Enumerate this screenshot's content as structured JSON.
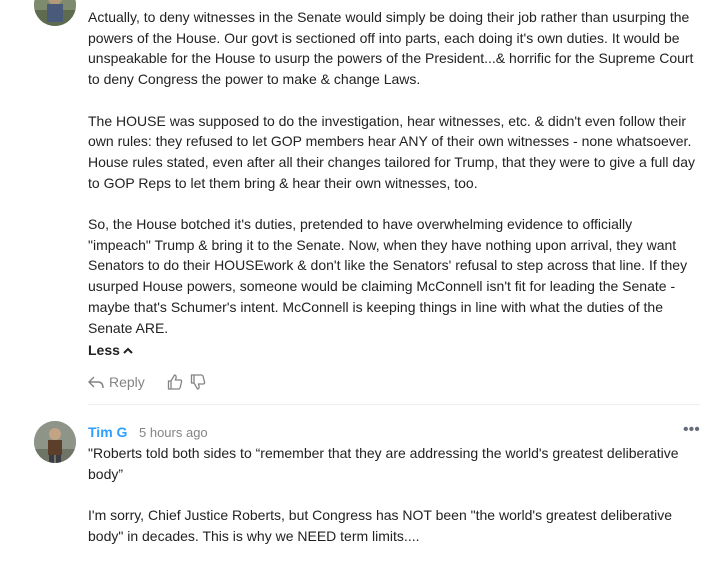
{
  "comment1": {
    "paragraphs": [
      "Actually, to deny witnesses in the Senate would simply be doing their job rather than usurping the powers of the House. Our govt is sectioned off into parts, each doing it's own duties. It would be unspeakable for the House to usurp the powers of the President...& horrific for the Supreme Court to deny Congress the power to make & change Laws.",
      "The HOUSE was supposed to do the investigation, hear witnesses, etc. & didn't even follow their own rules: they refused to let GOP members hear ANY of their own witnesses - none whatsoever. House rules stated, even after all their changes tailored for Trump, that they were to give a full day to GOP Reps to let them bring & hear their own witnesses, too.",
      "So, the House botched it's duties, pretended to have overwhelming evidence to officially \"impeach\" Trump & bring it to the Senate. Now, when they have nothing upon arrival, they want Senators to do their HOUSEwork & don't like the Senators' refusal to step across that line. If they usurped House powers, someone would be claiming McConnell isn't fit for leading the Senate - maybe that's Schumer's intent. McConnell is keeping things in line with what the duties of the Senate ARE."
    ],
    "less_label": "Less",
    "reply_label": "Reply",
    "icons": {
      "reply": "reply-arrow-icon",
      "upvote": "thumbs-up-icon",
      "downvote": "thumbs-down-icon",
      "collapse": "chevron-up-icon"
    }
  },
  "comment2": {
    "author": "Tim G",
    "timestamp": "5 hours ago",
    "more_label": "•••",
    "paragraphs": [
      "\"Roberts told both sides to “remember that they are addressing the world's greatest deliberative body”",
      "I'm sorry, Chief Justice Roberts, but Congress has NOT been \"the world's greatest deliberative body\" in decades. This is why we NEED term limits...."
    ]
  },
  "colors": {
    "author_link": "#2e9fff",
    "meta_gray": "#848484",
    "text": "#222222"
  }
}
